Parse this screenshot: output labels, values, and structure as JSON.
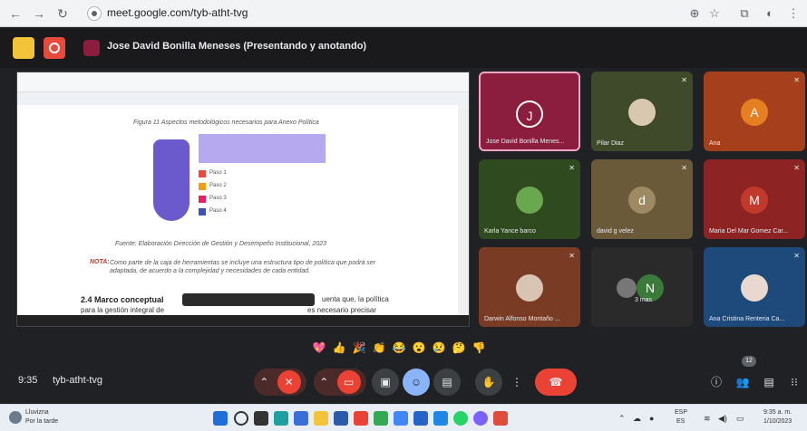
{
  "browser": {
    "url": "meet.google.com/tyb-atht-tvg",
    "nav": {
      "back": "←",
      "forward": "→",
      "reload": "↻"
    },
    "toolbar_icons": [
      "zoom-icon",
      "star-icon",
      "extensions-icon",
      "profile-icon",
      "menu-icon"
    ]
  },
  "presenter": {
    "label": "Jose David Bonilla Meneses (Presentando y anotando)"
  },
  "shared_doc": {
    "figure_caption": "Figura 11 Aspectos metodológicos necesarios para Anexo Política",
    "source_caption": "Fuente: Elaboración Dirección de Gestión y Desempeño Institucional, 2023",
    "nota_label": "NOTA:",
    "nota_text": "Como parte de la caja de herramientas se incluye una estructura tipo de política que podrá ser adaptada, de acuerdo a la complejidad y necesidades de cada entidad.",
    "section_heading": "2.4 Marco conceptual",
    "section_tail": "uenta que, la política",
    "body_line": "para la gestión integral de",
    "body_line_tail": "es necesario precisar",
    "figure_steps": [
      "Paso 1",
      "Paso 2",
      "Paso 3",
      "Paso 4"
    ]
  },
  "tiles": [
    {
      "name": "Jose David Bonilla Menes...",
      "initial": "J",
      "color": "#8b1e3f",
      "kind": "outline"
    },
    {
      "name": "Pilar Diaz",
      "initial": "",
      "color": "#3e4a2a",
      "kind": "photo"
    },
    {
      "name": "Ana",
      "initial": "A",
      "color": "#a53f1c",
      "kind": "avatar"
    },
    {
      "name": "Karla Yance barco",
      "initial": "",
      "color": "#2f4a1e",
      "kind": "photo"
    },
    {
      "name": "david g velez",
      "initial": "d",
      "color": "#6b5a3a",
      "kind": "avatar"
    },
    {
      "name": "Maria Del Mar Gomez Car...",
      "initial": "M",
      "color": "#8e2323",
      "kind": "avatar"
    },
    {
      "name": "Darwin Alfonso Montaño ...",
      "initial": "",
      "color": "#7a3b24",
      "kind": "photo"
    },
    {
      "name": "3 mas",
      "initial": "N",
      "color": "#2a2a2a",
      "kind": "more"
    },
    {
      "name": "Ana Cristina Renteria Ca...",
      "initial": "",
      "color": "#1d4a7a",
      "kind": "photo"
    }
  ],
  "reactions": [
    "💖",
    "👍",
    "🎉",
    "👏",
    "😂",
    "😮",
    "😢",
    "🤔",
    "👎"
  ],
  "controls": {
    "time": "9:35",
    "code": "tyb-atht-tvg",
    "participants_count": "12",
    "buttons": [
      "mic-off",
      "camera-off",
      "present",
      "emoji",
      "captions",
      "raise-hand",
      "more",
      "leave"
    ],
    "colors": {
      "danger": "#ea4335",
      "blue": "#8ab4f8",
      "dark_red": "#4d2a2a"
    }
  },
  "taskbar": {
    "weather_temp": "Lluvizna",
    "weather_sub": "Por la tarde",
    "lang": "ESP",
    "lang_sub": "ES",
    "clock_time": "9:35 a. m.",
    "clock_date": "1/10/2023"
  }
}
